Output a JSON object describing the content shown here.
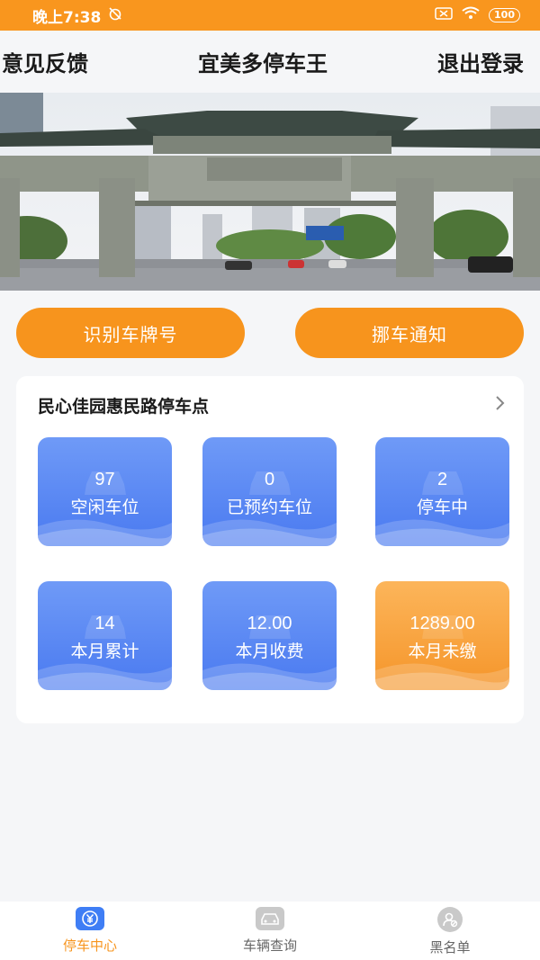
{
  "status_bar": {
    "time": "晚上7:38",
    "battery": "100"
  },
  "header": {
    "left": "意见反馈",
    "title": "宜美多停车王",
    "right": "退出登录"
  },
  "banner": {
    "image_icon": "memorial-archway-photo"
  },
  "actions": {
    "recognize_plate": "识别车牌号",
    "move_car_notice": "挪车通知"
  },
  "parking_card": {
    "location": "民心佳园惠民路停车点",
    "tiles": [
      {
        "value": "97",
        "label": "空闲车位",
        "color": "#4a7af0"
      },
      {
        "value": "0",
        "label": "已预约车位",
        "color": "#4a7af0"
      },
      {
        "value": "2",
        "label": "停车中",
        "color": "#4a7af0"
      },
      {
        "value": "14",
        "label": "本月累计",
        "color": "#4a7af0"
      },
      {
        "value": "12.00",
        "label": "本月收费",
        "color": "#4a7af0"
      },
      {
        "value": "1289.00",
        "label": "本月未缴",
        "color": "#f5952a"
      }
    ]
  },
  "bottom_nav": {
    "items": [
      {
        "label": "停车中心",
        "icon": "yuan-icon",
        "active": true
      },
      {
        "label": "车辆查询",
        "icon": "car-icon",
        "active": false
      },
      {
        "label": "黑名单",
        "icon": "user-block-icon",
        "active": false
      }
    ]
  },
  "colors": {
    "accent": "#f7941d",
    "tile_blue": "#4a7af0",
    "tile_orange": "#f5952a"
  }
}
